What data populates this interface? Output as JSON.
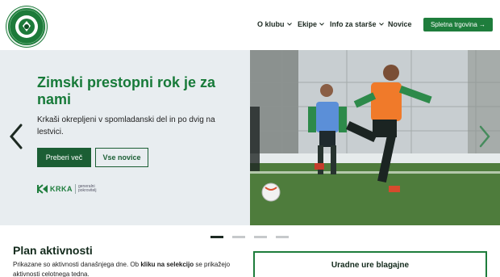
{
  "header": {
    "logo_alt": "Nogometni klub Krka",
    "nav": [
      {
        "label": "O klubu",
        "dropdown": true
      },
      {
        "label": "Ekipe",
        "dropdown": true
      },
      {
        "label": "Info za starše",
        "dropdown": true
      },
      {
        "label": "Novice",
        "dropdown": false
      }
    ],
    "shop_label": "Spletna trgovina →"
  },
  "hero": {
    "title": "Zimski prestopni rok je za nami",
    "text": "Krkaši okrepljeni v spomladanski del in po dvig na lestvici.",
    "primary_label": "Preberi več",
    "secondary_label": "Vse novice",
    "sponsor": {
      "name": "KRKA",
      "label_line1": "generalni",
      "label_line2": "pokrovitelj"
    },
    "slides_total": 4,
    "active_slide": 1
  },
  "plan": {
    "title": "Plan aktivnosti",
    "text_prefix": "Prikazane so aktivnosti današnjega dne. Ob ",
    "text_bold": "kliku na selekcijo",
    "text_suffix": " se prikažejo aktivnosti celotnega tedna."
  },
  "hours": {
    "title": "Uradne ure blagajne"
  },
  "colors": {
    "brand_green": "#1e7d3c",
    "dark_green": "#1b5e34",
    "title_green": "#177a39"
  }
}
